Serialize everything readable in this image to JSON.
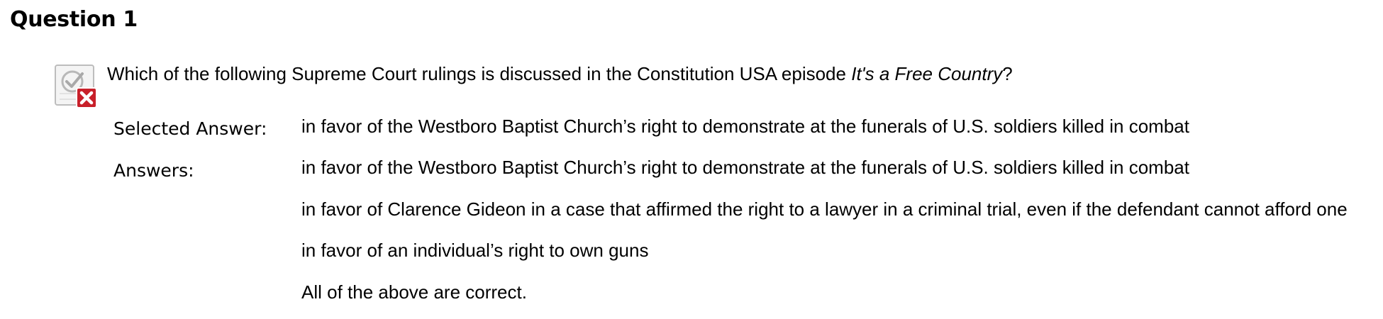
{
  "question": {
    "title": "Question 1",
    "status_icon": "incorrect-icon",
    "text_before": "Which of the following Supreme Court rulings is discussed in the Constitution USA episode ",
    "text_italic": "It's a Free Country",
    "text_after": "?"
  },
  "selected": {
    "label": "Selected Answer:",
    "value": "in favor of the Westboro Baptist Church’s right to demonstrate at the funerals of U.S. soldiers killed in combat"
  },
  "answers": {
    "label": "Answers:",
    "items": [
      "in favor of the Westboro Baptist Church’s right to demonstrate at the funerals of U.S. soldiers killed in combat",
      "in favor of Clarence Gideon in a case that affirmed the right to a lawyer in a criminal trial, even if the defendant cannot afford one",
      "in favor of an individual’s right to own guns",
      "All of the above are correct."
    ]
  },
  "colors": {
    "incorrect_badge": "#c8202a",
    "icon_border": "#bdbdbd"
  }
}
